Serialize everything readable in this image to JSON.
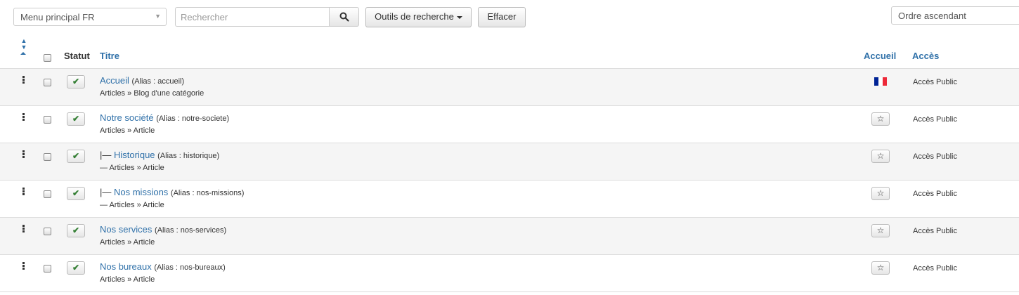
{
  "toolbar": {
    "menu_select": "Menu principal FR",
    "search_placeholder": "Rechercher",
    "search_tools_label": "Outils de recherche",
    "clear_label": "Effacer",
    "order_select": "Ordre ascendant"
  },
  "table": {
    "headers": {
      "status": "Statut",
      "title": "Titre",
      "home": "Accueil",
      "access": "Accès"
    },
    "rows": [
      {
        "prefix": "",
        "title": "Accueil",
        "alias": "(Alias : accueil)",
        "type": "Articles » Blog d'une catégorie",
        "home": "flag-fr",
        "access": "Accès Public"
      },
      {
        "prefix": "",
        "title": "Notre société",
        "alias": "(Alias : notre-societe)",
        "type": "Articles » Article",
        "home": "star",
        "access": "Accès Public"
      },
      {
        "prefix": "|— ",
        "title": "Historique",
        "alias": "(Alias : historique)",
        "type": "— Articles » Article",
        "home": "star",
        "access": "Accès Public"
      },
      {
        "prefix": "|— ",
        "title": "Nos missions",
        "alias": "(Alias : nos-missions)",
        "type": "— Articles » Article",
        "home": "star",
        "access": "Accès Public"
      },
      {
        "prefix": "",
        "title": "Nos services",
        "alias": "(Alias : nos-services)",
        "type": "Articles » Article",
        "home": "star",
        "access": "Accès Public"
      },
      {
        "prefix": "",
        "title": "Nos bureaux",
        "alias": "(Alias : nos-bureaux)",
        "type": "Articles » Article",
        "home": "star",
        "access": "Accès Public"
      }
    ]
  },
  "colors": {
    "link": "#3071a9",
    "published_check": "#378137",
    "flag_blue": "#002395",
    "flag_white": "#ffffff",
    "flag_red": "#ed2939"
  },
  "icons": {
    "search": "search-icon",
    "status": "check-icon",
    "home_default": "star-icon",
    "home_language": "flag-fr-icon",
    "drag": "drag-handle-icon",
    "sort": "sort-icon"
  }
}
